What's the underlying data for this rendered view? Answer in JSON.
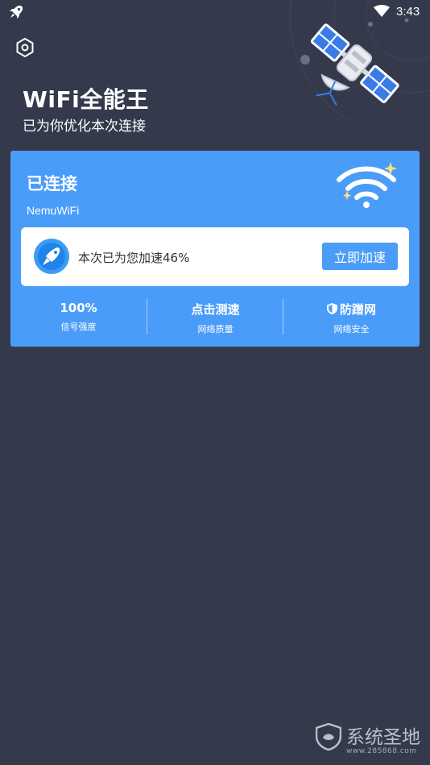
{
  "status_bar": {
    "time": "3:43"
  },
  "header": {
    "title": "WiFi全能王",
    "subtitle": "已为你优化本次连接"
  },
  "card": {
    "status": "已连接",
    "ssid": "NemuWiFi",
    "boost": {
      "text": "本次已为您加速46%",
      "button_label": "立即加速"
    },
    "stats": [
      {
        "value": "100%",
        "label": "信号强度"
      },
      {
        "value": "点击测速",
        "label": "网络质量"
      },
      {
        "value": "防蹭网",
        "label": "网络安全"
      }
    ]
  },
  "watermark": {
    "text": "系统圣地",
    "url": "www.285868.com"
  },
  "colors": {
    "background": "#343a4b",
    "card": "#4a9cf9",
    "panel": "#ffffff"
  }
}
